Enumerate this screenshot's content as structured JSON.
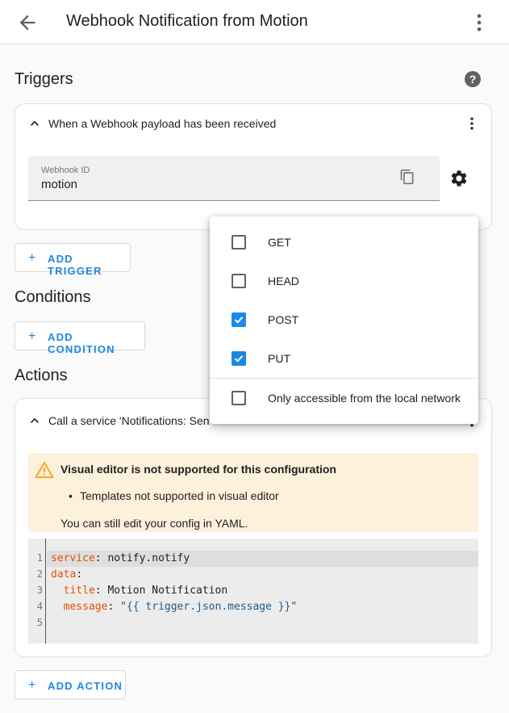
{
  "header": {
    "title": "Webhook Notification from Motion",
    "back_icon": "arrow-left-icon",
    "menu_icon": "dots-vertical-icon"
  },
  "triggers": {
    "title": "Triggers",
    "card_title": "When a Webhook payload has been received",
    "webhook_id_label": "Webhook ID",
    "webhook_id_value": "motion",
    "add_label": "ADD TRIGGER"
  },
  "conditions": {
    "title": "Conditions",
    "add_label": "ADD CONDITION"
  },
  "actions": {
    "title": "Actions",
    "card_title": "Call a service 'Notifications: Sen",
    "warning_title": "Visual editor is not supported for this configuration",
    "warning_bullet": "Templates not supported in visual editor",
    "warning_note": "You can still edit your config in YAML.",
    "code_lines": [
      "1",
      "2",
      "3",
      "4",
      "5"
    ],
    "code": {
      "l1_key": "service",
      "l1_val": "notify.notify",
      "l2_key": "data",
      "l3_key": "title",
      "l3_val": "Motion Notification",
      "l4_key": "message",
      "l4_val": "\"{{ trigger.json.message }}\""
    },
    "add_label": "ADD ACTION"
  },
  "methods_menu": {
    "items": [
      {
        "label": "GET",
        "checked": false
      },
      {
        "label": "HEAD",
        "checked": false
      },
      {
        "label": "POST",
        "checked": true
      },
      {
        "label": "PUT",
        "checked": true
      }
    ],
    "local_only": {
      "label": "Only accessible from the local network",
      "checked": false
    }
  },
  "colors": {
    "accent": "#1e88e5",
    "warning_bg": "#fdf1dc",
    "warning_icon": "#f9a825"
  }
}
